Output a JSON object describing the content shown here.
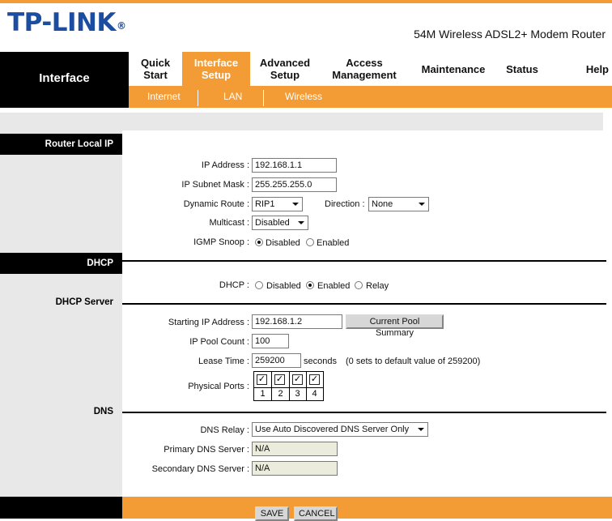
{
  "header": {
    "logo_text": "TP-LINK",
    "logo_mark": "®",
    "product": "54M Wireless ADSL2+ Modem Router"
  },
  "nav": {
    "section_title": "Interface",
    "tabs": [
      {
        "label": "Quick\nStart",
        "active": false
      },
      {
        "label": "Interface\nSetup",
        "active": true
      },
      {
        "label": "Advanced\nSetup",
        "active": false
      },
      {
        "label": "Access\nManagement",
        "active": false
      },
      {
        "label": "Maintenance",
        "active": false
      },
      {
        "label": "Status",
        "active": false
      },
      {
        "label": "Help",
        "active": false
      }
    ],
    "subtabs": [
      "Internet",
      "LAN",
      "Wireless"
    ]
  },
  "router_local_ip": {
    "title": "Router Local IP",
    "ip_address_label": "IP Address :",
    "ip_address": "192.168.1.1",
    "subnet_mask_label": "IP Subnet Mask :",
    "subnet_mask": "255.255.255.0",
    "dynamic_route_label": "Dynamic Route :",
    "dynamic_route": "RIP1",
    "direction_label": "Direction :",
    "direction": "None",
    "multicast_label": "Multicast :",
    "multicast": "Disabled",
    "igmp_label": "IGMP Snoop :",
    "igmp_options": [
      "Disabled",
      "Enabled"
    ],
    "igmp_selected": "Disabled"
  },
  "dhcp": {
    "title": "DHCP",
    "dhcp_label": "DHCP :",
    "options": [
      "Disabled",
      "Enabled",
      "Relay"
    ],
    "selected": "Enabled"
  },
  "dhcp_server": {
    "title": "DHCP Server",
    "start_ip_label": "Starting IP Address :",
    "start_ip": "192.168.1.2",
    "pool_summary_button": "Current Pool Summary",
    "pool_count_label": "IP Pool Count :",
    "pool_count": "100",
    "lease_time_label": "Lease Time :",
    "lease_time": "259200",
    "lease_unit": "seconds",
    "lease_note": "(0 sets to default value of 259200)",
    "physical_ports_label": "Physical Ports :",
    "ports": [
      {
        "number": "1",
        "checked": true
      },
      {
        "number": "2",
        "checked": true
      },
      {
        "number": "3",
        "checked": true
      },
      {
        "number": "4",
        "checked": true
      }
    ],
    "check_mark": "✓"
  },
  "dns": {
    "title": "DNS",
    "relay_label": "DNS Relay :",
    "relay": "Use Auto Discovered DNS Server Only",
    "primary_label": "Primary DNS Server :",
    "primary": "N/A",
    "secondary_label": "Secondary DNS Server :",
    "secondary": "N/A"
  },
  "footer": {
    "save_button": "SAVE",
    "cancel_button": "CANCEL"
  },
  "colors": {
    "accent": "#f39c36",
    "logo": "#1b4ea1",
    "panel": "#e8e8e8"
  }
}
